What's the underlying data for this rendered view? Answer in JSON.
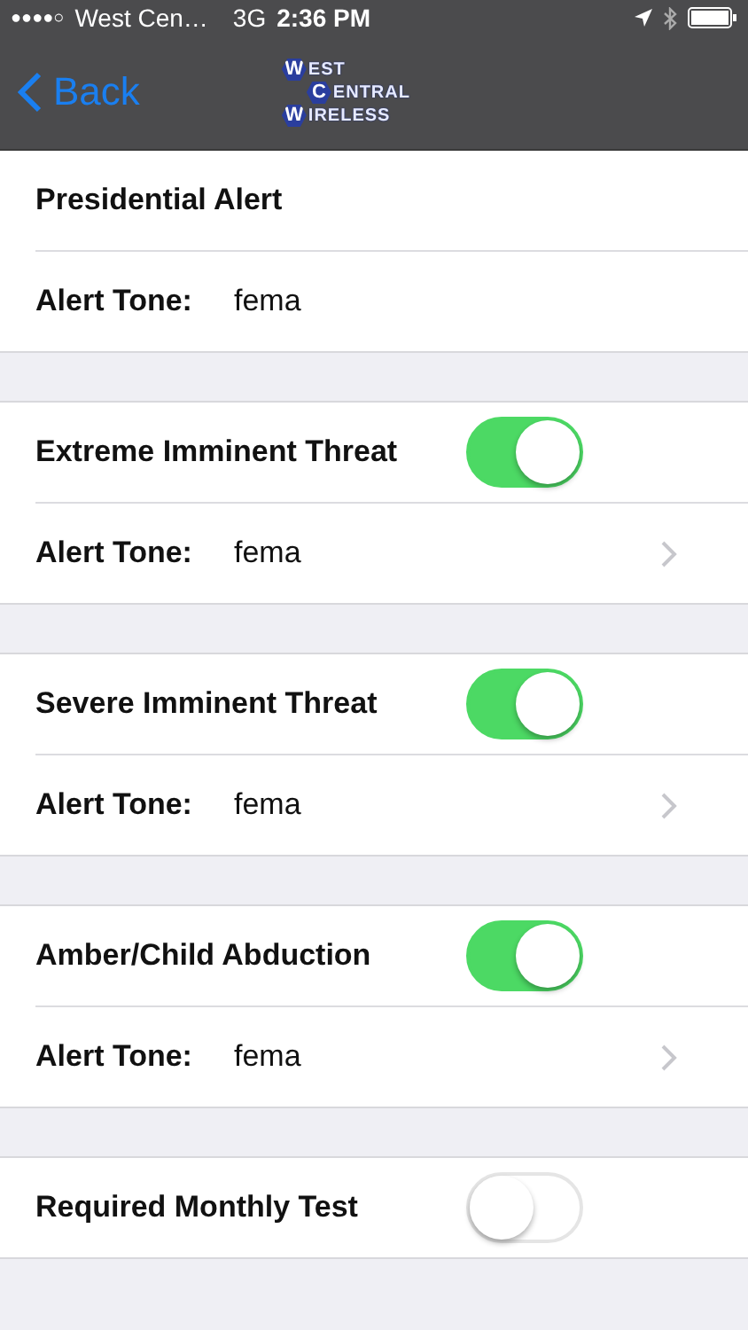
{
  "status_bar": {
    "signal_dots": "●●●●○",
    "carrier": "West Cen…",
    "network": "3G",
    "time": "2:36 PM"
  },
  "nav": {
    "back": "Back",
    "logo": [
      {
        "initial": "W",
        "rest": "EST"
      },
      {
        "initial": "C",
        "rest": "ENTRAL"
      },
      {
        "initial": "W",
        "rest": "IRELESS"
      }
    ]
  },
  "sections": [
    {
      "kind": "static",
      "title": "Presidential Alert",
      "tone": {
        "label": "Alert Tone:",
        "value": "fema",
        "chevron": false
      }
    },
    {
      "kind": "switch",
      "title": "Extreme Imminent Threat",
      "on": true,
      "tone": {
        "label": "Alert Tone:",
        "value": "fema",
        "chevron": true
      }
    },
    {
      "kind": "switch",
      "title": "Severe Imminent Threat",
      "on": true,
      "tone": {
        "label": "Alert Tone:",
        "value": "fema",
        "chevron": true
      }
    },
    {
      "kind": "switch",
      "title": "Amber/Child Abduction",
      "on": true,
      "tone": {
        "label": "Alert Tone:",
        "value": "fema",
        "chevron": true
      }
    },
    {
      "kind": "switch",
      "title": "Required Monthly Test",
      "on": false
    }
  ]
}
